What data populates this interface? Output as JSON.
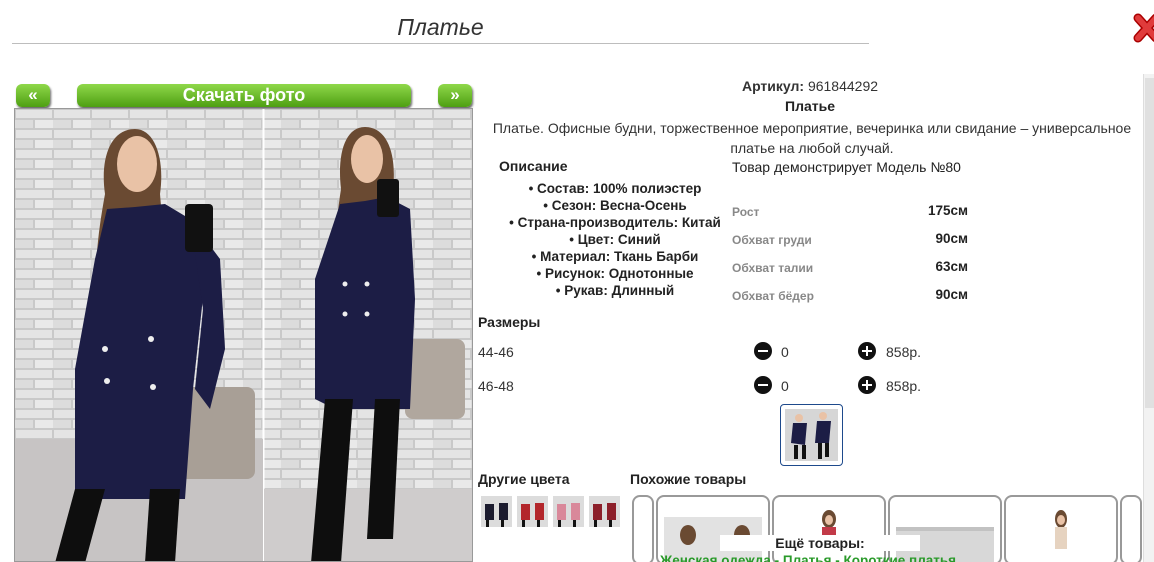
{
  "page_title": "Платье",
  "nav": {
    "prev_label": "«",
    "next_label": "»",
    "download_label": "Скачать фото"
  },
  "product": {
    "sku_label": "Артикул:",
    "sku_value": "961844292",
    "name": "Платье",
    "description": "Платье. Офисные будни, торжественное мероприятие, вечеринка или свидание – универсальное платье на любой случай."
  },
  "description_section": {
    "heading": "Описание",
    "props": [
      "Состав: 100% полиэстер",
      "Сезон: Весна-Осень",
      "Страна-производитель: Китай",
      "Цвет: Синий",
      "Материал: Ткань Барби",
      "Рисунок: Однотонные",
      "Рукав: Длинный"
    ]
  },
  "model": {
    "heading": "Товар демонстрирует Модель №80",
    "rows": [
      {
        "label": "Рост",
        "value": "175см"
      },
      {
        "label": "Обхват груди",
        "value": "90см"
      },
      {
        "label": "Обхват талии",
        "value": "63см"
      },
      {
        "label": "Обхват бёдер",
        "value": "90см"
      }
    ]
  },
  "sizes": {
    "heading": "Размеры",
    "rows": [
      {
        "size": "44-46",
        "qty": "0",
        "price": "858р."
      },
      {
        "size": "46-48",
        "qty": "0",
        "price": "858р."
      }
    ]
  },
  "other_colors": {
    "heading": "Другие цвета",
    "colors": [
      "#1b1b2e",
      "#b3262b",
      "#d9889a",
      "#8c1f2a"
    ]
  },
  "similar": {
    "heading": "Похожие товары"
  },
  "more": {
    "heading": "Ещё товары:",
    "links": [
      "Женская одежда",
      "Платья",
      "Короткие платья"
    ],
    "separator": " - "
  },
  "colors": {
    "accent_green": "#5db51c",
    "dress_navy": "#1c1d45",
    "link_green": "#2a9a2a"
  },
  "icons": [
    "close-icon",
    "minus-icon",
    "plus-icon"
  ]
}
